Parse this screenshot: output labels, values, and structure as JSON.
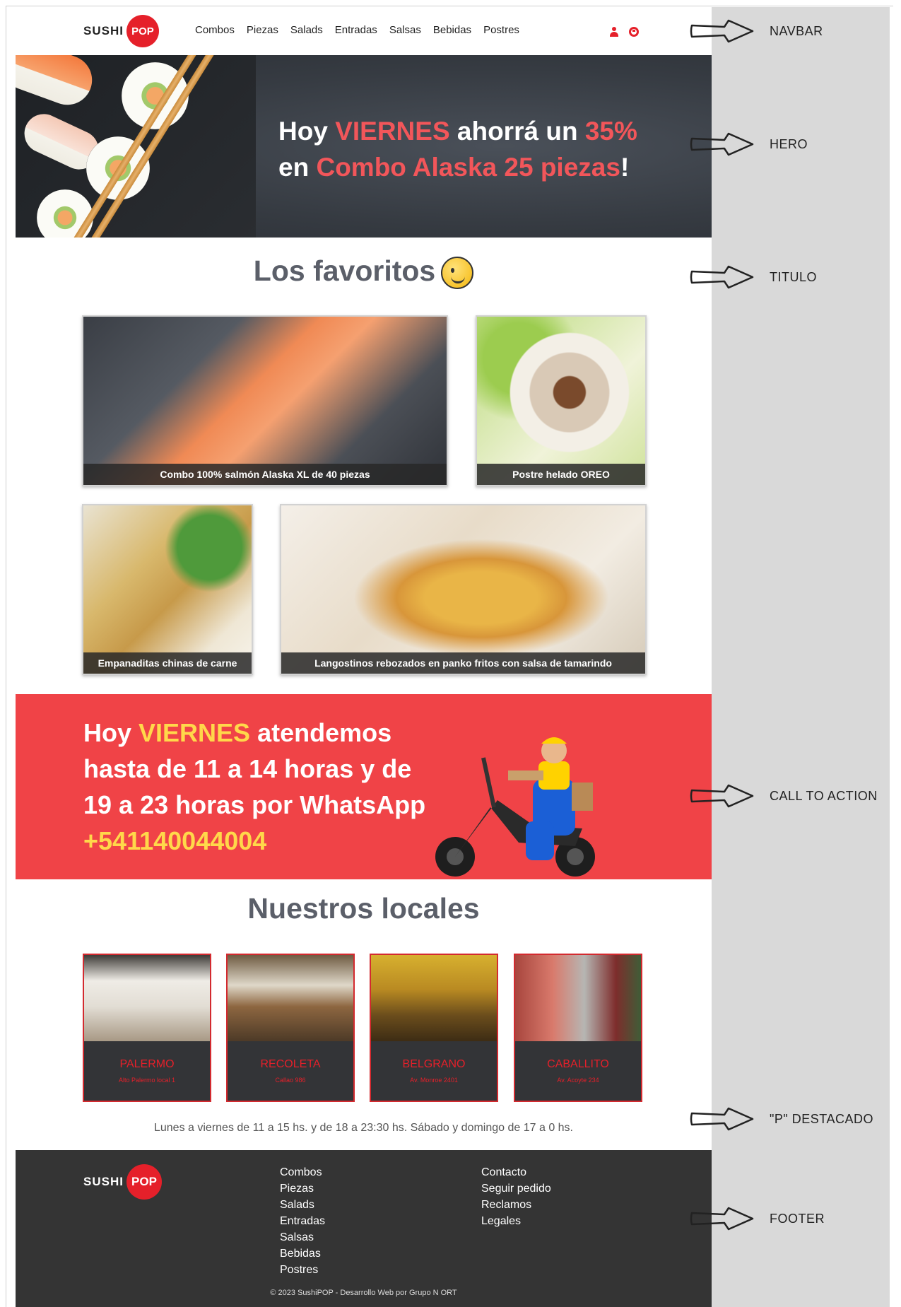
{
  "navbar": {
    "logo": {
      "word": "SUSHI",
      "badge": "POP"
    },
    "links": [
      "Combos",
      "Piezas",
      "Salads",
      "Entradas",
      "Salsas",
      "Bebidas",
      "Postres"
    ],
    "icons": [
      "user-icon",
      "cart-icon"
    ]
  },
  "hero": {
    "line1": {
      "a": "Hoy ",
      "b": "VIERNES",
      "c": " ahorrá un ",
      "d": "35%"
    },
    "line2": {
      "a": "en ",
      "b": "Combo Alaska 25 piezas",
      "c": "!"
    }
  },
  "favorites": {
    "title": "Los favoritos",
    "emoji": "winking-face-icon",
    "items": [
      {
        "caption": "Combo 100% salmón Alaska XL de 40 piezas"
      },
      {
        "caption": "Postre helado OREO"
      },
      {
        "caption": "Empanaditas chinas de carne"
      },
      {
        "caption": "Langostinos rebozados en panko fritos con salsa de tamarindo"
      }
    ]
  },
  "cta": {
    "line1": {
      "a": "Hoy ",
      "b": "VIERNES",
      "c": " atendemos"
    },
    "line2": "hasta de 11 a 14 horas y de",
    "line3": "19 a 23 horas por WhatsApp",
    "phone": "+541140044004"
  },
  "locales": {
    "title": "Nuestros locales",
    "items": [
      {
        "name": "PALERMO",
        "address": "Alto Palermo local 1"
      },
      {
        "name": "RECOLETA",
        "address": "Callao 986"
      },
      {
        "name": "BELGRANO",
        "address": "Av. Monroe 2401"
      },
      {
        "name": "CABALLITO",
        "address": "Av. Acoyte 234"
      }
    ]
  },
  "hours": "Lunes a viernes de 11 a 15 hs. y de 18 a 23:30 hs. Sábado y domingo de 17 a 0 hs.",
  "footer": {
    "logo": {
      "word": "SUSHI",
      "badge": "POP"
    },
    "col1": [
      "Combos",
      "Piezas",
      "Salads",
      "Entradas",
      "Salsas",
      "Bebidas",
      "Postres"
    ],
    "col2": [
      "Contacto",
      "Seguir pedido",
      "Reclamos",
      "Legales"
    ],
    "copyright": "© 2023 SushiPOP - Desarrollo Web por Grupo N ORT"
  },
  "annotations": [
    "NAVBAR",
    "HERO",
    "TITULO",
    "CALL TO ACTION",
    "\"P\" DESTACADO",
    "FOOTER"
  ],
  "colors": {
    "brand_red": "#e5202a",
    "cta_red": "#f04347",
    "highlight_yellow": "#ffd84a",
    "hero_highlight": "#f2565a",
    "footer_bg": "#343434"
  }
}
